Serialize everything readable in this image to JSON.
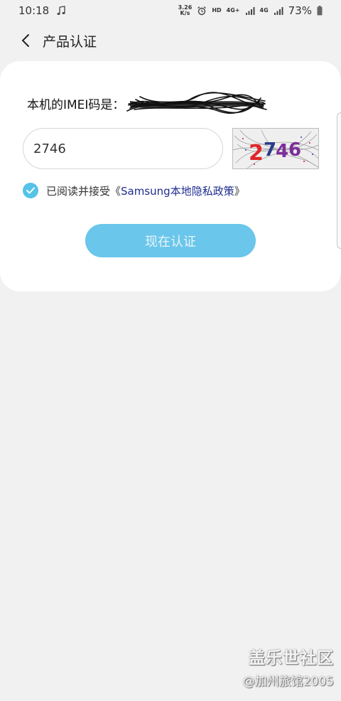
{
  "status_bar": {
    "time": "10:18",
    "net_speed_value": "3.26",
    "net_speed_unit": "K/s",
    "hd_label": "HD",
    "network_4g_a": "4G+",
    "network_4g_b": "4G",
    "battery": "73%",
    "icons": [
      "music-note-icon",
      "alarm-icon",
      "signal-icon",
      "battery-icon"
    ]
  },
  "app_bar": {
    "title": "产品认证"
  },
  "imei": {
    "label": "本机的IMEI码是："
  },
  "verification": {
    "code_value": "2746",
    "captcha_text": "2746"
  },
  "agreement": {
    "prefix": "已阅读并接受《",
    "policy_link": "Samsung本地隐私政策",
    "suffix": "》",
    "checked": true
  },
  "verify_button": {
    "label": "现在认证"
  },
  "watermark": {
    "title": "盖乐世社区",
    "subtitle": "@加州旅馆2005"
  },
  "colors": {
    "accent": "#55c2e7",
    "button": "#6ac6ea",
    "link": "#1f2d8f",
    "background": "#f1f1f1"
  }
}
